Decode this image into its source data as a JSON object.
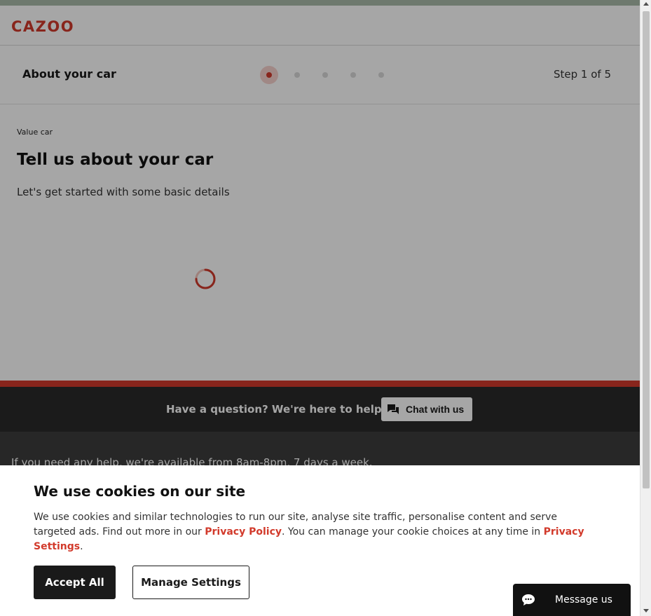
{
  "brand": {
    "logo_text": "CAZOO",
    "accent_color": "#d23a2b"
  },
  "progress": {
    "title": "About your car",
    "current_step": 1,
    "total_steps": 5,
    "step_label": "Step 1 of 5"
  },
  "content": {
    "eyebrow": "Value car",
    "heading": "Tell us about your car",
    "subheading": "Let's get started with some basic details",
    "loading_icon": "spinner-icon"
  },
  "help_bar": {
    "text": "Have a question? We're here to help.",
    "chat_button_label": "Chat with us",
    "chat_icon": "chat-bubbles-icon"
  },
  "footer": {
    "text": "If you need any help, we're available from 8am-8pm, 7 days a week."
  },
  "cookie_banner": {
    "title": "We use cookies on our site",
    "body_part1": "We use cookies and similar technologies to run our site, analyse site traffic, personalise content and serve targeted ads. Find out more in our ",
    "privacy_policy_link": "Privacy Policy",
    "body_part2": ". You can manage your cookie choices at any time in ",
    "privacy_settings_link": "Privacy Settings",
    "body_part3": ".",
    "accept_label": "Accept All",
    "manage_label": "Manage Settings"
  },
  "message_widget": {
    "label": "Message us",
    "icon": "message-bubble-icon"
  }
}
